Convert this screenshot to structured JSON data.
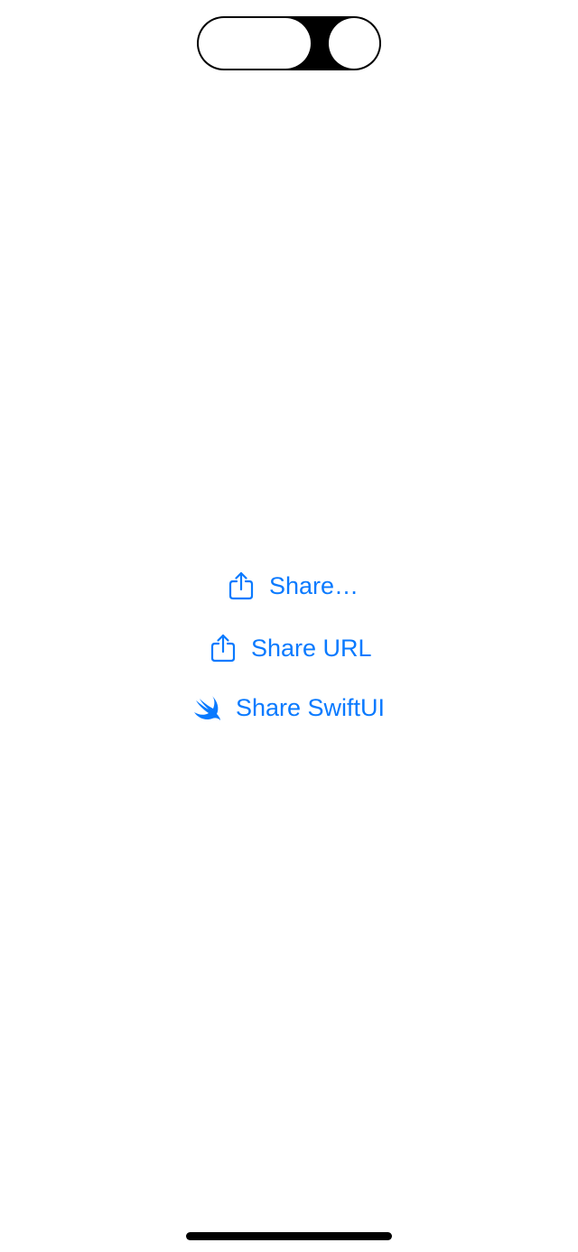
{
  "colors": {
    "accent": "#0a7aff",
    "background": "#ffffff"
  },
  "actions": [
    {
      "label": "Share…",
      "icon": "share-icon"
    },
    {
      "label": "Share URL",
      "icon": "share-icon"
    },
    {
      "label": "Share SwiftUI",
      "icon": "swift-icon"
    }
  ]
}
